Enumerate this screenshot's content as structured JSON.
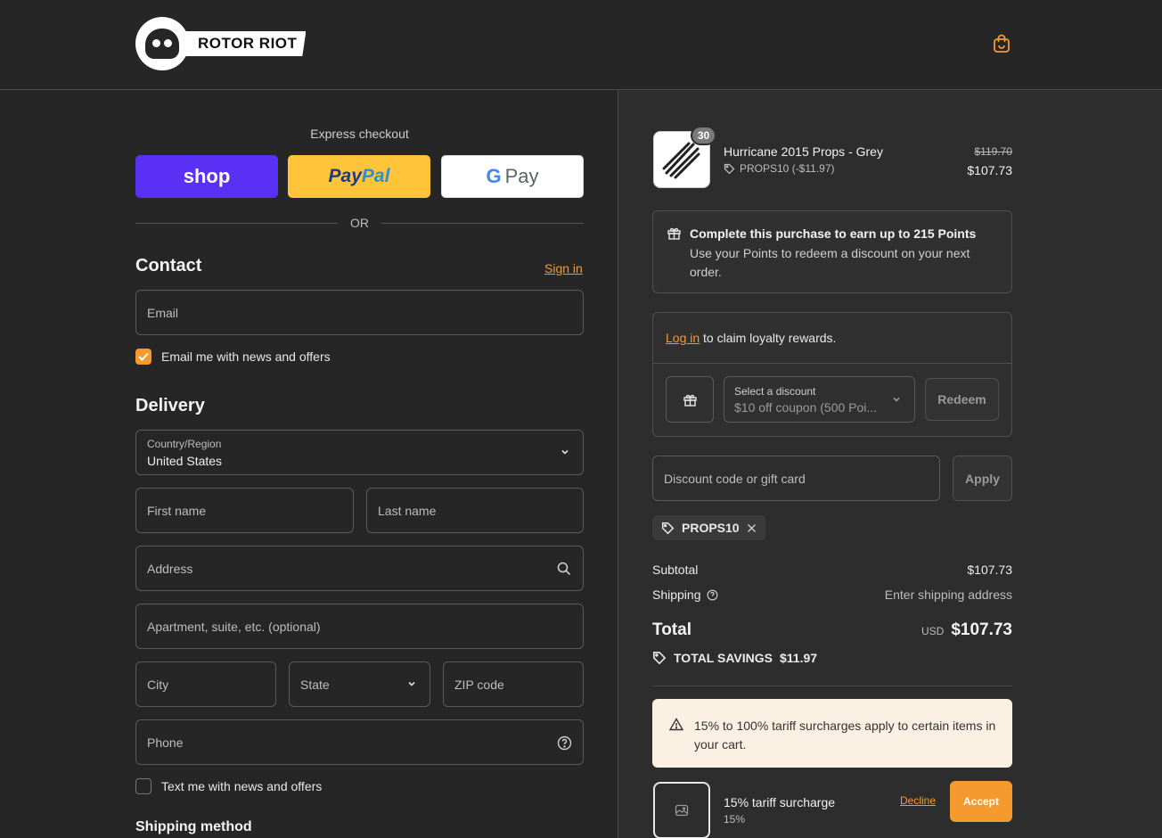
{
  "brand": {
    "name": "ROTOR RIOT",
    "accent": "#f59a2e"
  },
  "express": {
    "title": "Express checkout",
    "shop_label": "shop",
    "paypal_label_a": "Pay",
    "paypal_label_b": "Pal",
    "gpay_g": "G",
    "gpay_label": "Pay",
    "or_label": "OR"
  },
  "contact": {
    "title": "Contact",
    "signin_label": "Sign in",
    "email_placeholder": "Email",
    "news_label": "Email me with news and offers",
    "news_checked": true
  },
  "delivery": {
    "title": "Delivery",
    "country_label": "Country/Region",
    "country_value": "United States",
    "first_name_placeholder": "First name",
    "last_name_placeholder": "Last name",
    "address_placeholder": "Address",
    "apartment_placeholder": "Apartment, suite, etc. (optional)",
    "city_placeholder": "City",
    "state_label": "State",
    "zip_placeholder": "ZIP code",
    "phone_placeholder": "Phone",
    "text_label": "Text me with news and offers",
    "text_checked": false
  },
  "shipping_method": {
    "title": "Shipping method"
  },
  "order": {
    "item": {
      "quantity": "30",
      "name": "Hurricane 2015 Props - Grey",
      "discount": "PROPS10 (-$11.97)",
      "price_original": "$119.70",
      "price_final": "$107.73"
    },
    "points": {
      "title": "Complete this purchase to earn up to 215 Points",
      "desc": "Use your Points to redeem a discount on your next order."
    },
    "loyalty": {
      "login_label": "Log in",
      "claim_text": " to claim loyalty rewards.",
      "select_label": "Select a discount",
      "select_value": "$10 off coupon (500 Poi...",
      "redeem_label": "Redeem"
    },
    "discount_code": {
      "placeholder": "Discount code or gift card",
      "apply_label": "Apply",
      "applied_tag": "PROPS10"
    },
    "summary": {
      "subtotal_label": "Subtotal",
      "subtotal_value": "$107.73",
      "shipping_label": "Shipping",
      "shipping_value": "Enter shipping address",
      "total_label": "Total",
      "currency": "USD",
      "total_value": "$107.73",
      "savings_label": "TOTAL SAVINGS",
      "savings_value": "$11.97"
    },
    "tariff_warning": "15% to 100% tariff surcharges apply to certain items in your cart.",
    "surcharge": {
      "name": "15% tariff surcharge",
      "pct": "15%",
      "decline_label": "Decline",
      "accept_label": "Accept"
    }
  }
}
